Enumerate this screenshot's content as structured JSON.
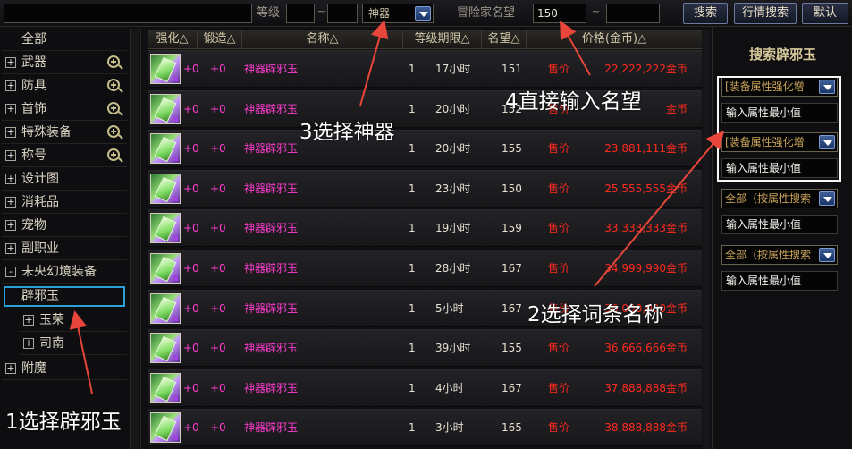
{
  "topbar": {
    "search_value": "",
    "level_label": "等级",
    "level_from": "",
    "level_sep": "~",
    "level_to": "",
    "rarity_selected": "神器",
    "fame_label": "冒险家名望",
    "fame_from": "150",
    "fame_sep": "~",
    "fame_to": "",
    "search_button": "搜索",
    "market_button": "行情搜索",
    "default_button": "默认"
  },
  "sidebar": {
    "items": [
      {
        "label": "全部",
        "expander": "",
        "zoom": false
      },
      {
        "label": "武器",
        "expander": "+",
        "zoom": true
      },
      {
        "label": "防具",
        "expander": "+",
        "zoom": true
      },
      {
        "label": "首饰",
        "expander": "+",
        "zoom": true
      },
      {
        "label": "特殊装备",
        "expander": "+",
        "zoom": true
      },
      {
        "label": "称号",
        "expander": "+",
        "zoom": true
      },
      {
        "label": "设计图",
        "expander": "+",
        "zoom": false
      },
      {
        "label": "消耗品",
        "expander": "+",
        "zoom": false
      },
      {
        "label": "宠物",
        "expander": "+",
        "zoom": false
      },
      {
        "label": "副职业",
        "expander": "+",
        "zoom": false
      },
      {
        "label": "未央幻境装备",
        "expander": "-",
        "zoom": false
      },
      {
        "label": "辟邪玉",
        "expander": "",
        "zoom": false
      },
      {
        "label": "玉荣",
        "expander": "+",
        "zoom": false
      },
      {
        "label": "司南",
        "expander": "+",
        "zoom": false
      },
      {
        "label": "附魔",
        "expander": "+",
        "zoom": false
      }
    ]
  },
  "table": {
    "headers": [
      "强化△",
      "锻造△",
      "名称△",
      "等级期限△",
      "名望△",
      "价格(金币)△"
    ],
    "rows": [
      {
        "enhance": "+0",
        "forge": "+0",
        "name": "神器辟邪玉",
        "level": "1",
        "duration": "17小时",
        "fame": "151",
        "sell": "售价",
        "price": "22,222,222",
        "coin": "金币"
      },
      {
        "enhance": "+0",
        "forge": "+0",
        "name": "神器辟邪玉",
        "level": "1",
        "duration": "20小时",
        "fame": "152",
        "sell": "售价",
        "price": "",
        "coin": "金币"
      },
      {
        "enhance": "+0",
        "forge": "+0",
        "name": "神器辟邪玉",
        "level": "1",
        "duration": "20小时",
        "fame": "155",
        "sell": "售价",
        "price": "23,881,111",
        "coin": "金币"
      },
      {
        "enhance": "+0",
        "forge": "+0",
        "name": "神器辟邪玉",
        "level": "1",
        "duration": "23小时",
        "fame": "150",
        "sell": "售价",
        "price": "25,555,555",
        "coin": "金币"
      },
      {
        "enhance": "+0",
        "forge": "+0",
        "name": "神器辟邪玉",
        "level": "1",
        "duration": "19小时",
        "fame": "159",
        "sell": "售价",
        "price": "33,333,333",
        "coin": "金币"
      },
      {
        "enhance": "+0",
        "forge": "+0",
        "name": "神器辟邪玉",
        "level": "1",
        "duration": "28小时",
        "fame": "167",
        "sell": "售价",
        "price": "34,999,990",
        "coin": "金币"
      },
      {
        "enhance": "+0",
        "forge": "+0",
        "name": "神器辟邪玉",
        "level": "1",
        "duration": "5小时",
        "fame": "167",
        "sell": "售价",
        "price": "36,000,000",
        "coin": "金币"
      },
      {
        "enhance": "+0",
        "forge": "+0",
        "name": "神器辟邪玉",
        "level": "1",
        "duration": "39小时",
        "fame": "155",
        "sell": "售价",
        "price": "36,666,666",
        "coin": "金币"
      },
      {
        "enhance": "+0",
        "forge": "+0",
        "name": "神器辟邪玉",
        "level": "1",
        "duration": "4小时",
        "fame": "167",
        "sell": "售价",
        "price": "37,888,888",
        "coin": "金币"
      },
      {
        "enhance": "+0",
        "forge": "+0",
        "name": "神器辟邪玉",
        "level": "1",
        "duration": "3小时",
        "fame": "165",
        "sell": "售价",
        "price": "38,888,888",
        "coin": "金币"
      }
    ]
  },
  "rpanel": {
    "title": "搜索辟邪玉",
    "filters": [
      {
        "combo": "[装备属性强化增",
        "min_placeholder": "输入属性最小值"
      },
      {
        "combo": "[装备属性强化增",
        "min_placeholder": "输入属性最小值"
      },
      {
        "combo": "全部（按属性搜索",
        "min_placeholder": "输入属性最小值"
      },
      {
        "combo": "全部（按属性搜索",
        "min_placeholder": "输入属性最小值"
      }
    ]
  },
  "annotations": {
    "step1": "1选择辟邪玉",
    "step2": "2选择词条名称",
    "step3": "3选择神器",
    "step4": "4直接输入名望"
  },
  "colors": {
    "annotation_arrow": "#e8463a",
    "item_name": "#ff3cd0",
    "price": "#ff2a1e",
    "selected_border": "#2aa0d8"
  }
}
